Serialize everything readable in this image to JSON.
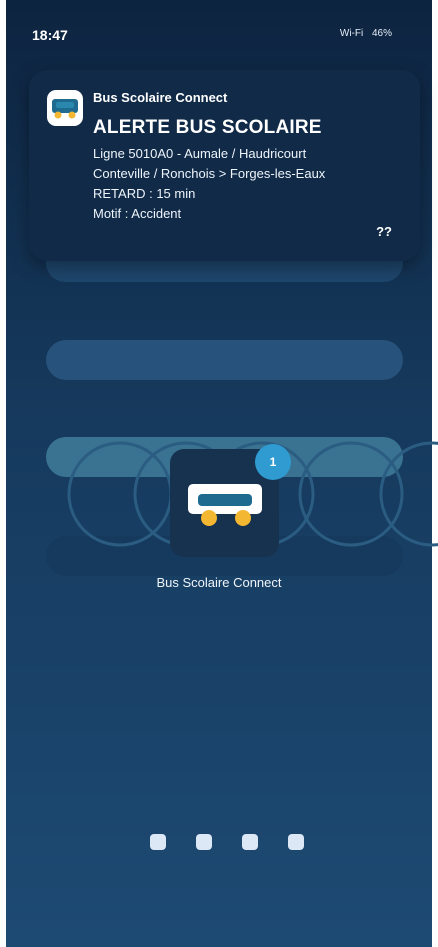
{
  "status_bar": {
    "time": "18:47",
    "wifi": "Wi-Fi",
    "battery": "46%"
  },
  "notification": {
    "app_name": "Bus Scolaire Connect",
    "title": "ALERTE BUS SCOLAIRE",
    "lines": [
      "Ligne 5010A0 - Aumale / Haudricourt",
      "Conteville / Ronchois > Forges-les-Eaux",
      "RETARD : 15 min",
      "Motif : Accident"
    ],
    "more": "??",
    "icon": "school-bus-icon"
  },
  "home": {
    "app_label": "Bus Scolaire Connect",
    "badge_count": "1",
    "app_icon": "school-bus-icon",
    "page_indicator_count": 4
  },
  "colors": {
    "accent": "#2f9bd1",
    "bus_body": "#1f6b8f",
    "wheel": "#f4b731"
  }
}
